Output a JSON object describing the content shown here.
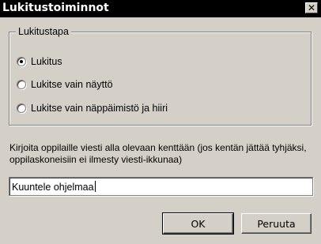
{
  "window": {
    "title": "Lukitustoiminnot",
    "close_label": "✕"
  },
  "lock_group": {
    "legend": "Lukitustapa",
    "options": [
      {
        "label": "Lukitus",
        "selected": true
      },
      {
        "label": "Lukitse vain näyttö",
        "selected": false
      },
      {
        "label": "Lukitse vain näppäimistö ja hiiri",
        "selected": false
      }
    ]
  },
  "message": {
    "instructions": "Kirjoita oppilaille viesti alla olevaan kenttään (jos kentän jättää tyhjäksi, oppilaskoneisiin ei ilmesty viesti-ikkunaa)",
    "value": "Kuuntele ohjelmaa"
  },
  "buttons": {
    "ok": "OK",
    "cancel": "Peruuta"
  }
}
